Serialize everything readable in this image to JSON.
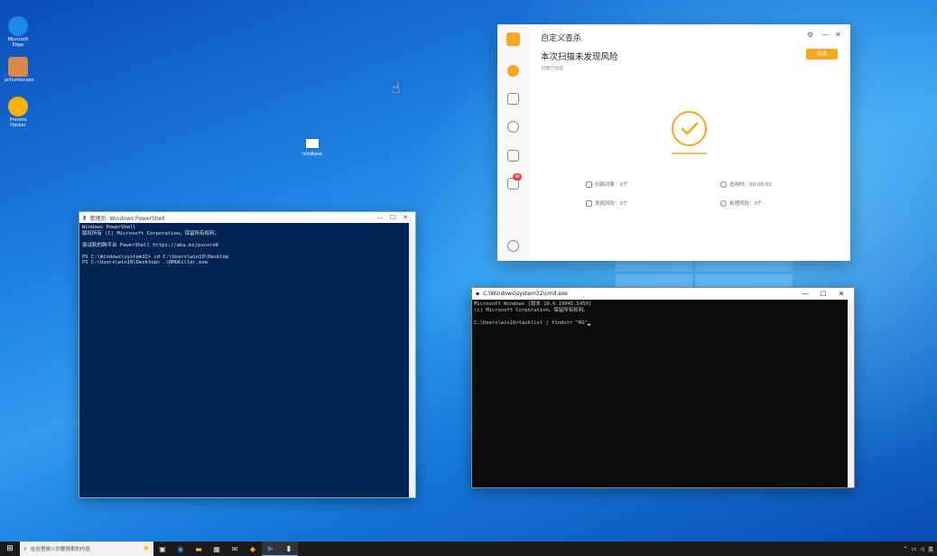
{
  "desktop": {
    "icons": [
      {
        "label": "Microsoft Edge",
        "color": "#1e88e5"
      },
      {
        "label": "pchunter.exe",
        "color": "#e0a060"
      },
      {
        "label": "Process Hacker",
        "color": "#ffb300"
      }
    ],
    "center_icon_label": "InfoBase"
  },
  "powershell": {
    "title": "管理员: Windows PowerShell",
    "lines": [
      "Windows PowerShell",
      "版权所有 (C) Microsoft Corporation。保留所有权利。",
      "",
      "尝试新的跨平台 PowerShell https://aka.ms/pscore6",
      "",
      "PS C:\\Windows\\system32> cd C:\\Users\\win10\\Desktop",
      "PS C:\\Users\\win10\\Desktop> .\\RMGKiller.exe"
    ]
  },
  "cmd": {
    "title": "C:\\Windows\\system32\\cmd.exe",
    "lines": [
      "Microsoft Windows [版本 10.0.19045.5450]",
      "(c) Microsoft Corporation。保留所有权利。",
      "",
      "C:\\Users\\win10>tasklist | findstr \"RG\""
    ]
  },
  "security_app": {
    "title": "自定义查杀",
    "headline": "本次扫描未发现风险",
    "subtext": "扫描已完成",
    "button": "完成",
    "badge": "99",
    "stats": {
      "scanned": "扫描对象：0个",
      "elapsed": "总用时：00:00:01",
      "found": "发现风险：0个",
      "handled": "处理风险：0个"
    }
  },
  "taskbar": {
    "search_placeholder": "在这里输入你要搜索的内容",
    "apps": [
      "任务视图",
      "Edge",
      "资源管理器",
      "应用商店",
      "邮件",
      "安全",
      "PowerShell",
      "命令提示符"
    ],
    "tray_lang": "英"
  }
}
